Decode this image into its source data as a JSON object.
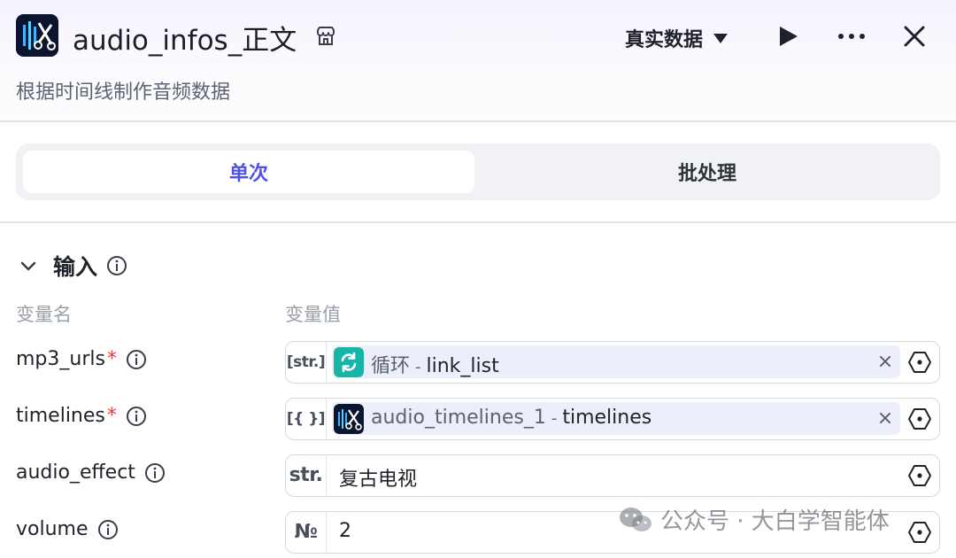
{
  "header": {
    "title": "audio_infos_正文",
    "subtitle": "根据时间线制作音频数据",
    "mode_label": "真实数据",
    "app_icon": "audio-scissors-icon",
    "title_icon": "store-icon"
  },
  "tabs": [
    {
      "label": "单次",
      "active": true
    },
    {
      "label": "批处理",
      "active": false
    }
  ],
  "input_section": {
    "title": "输入",
    "col_name": "变量名",
    "col_value": "变量值",
    "rows": [
      {
        "name": "mp3_urls",
        "required": "*",
        "type": "[str.]",
        "kind": "ref",
        "source": "循环",
        "sep": "-",
        "variable": "link_list"
      },
      {
        "name": "timelines",
        "required": "*",
        "type": "[{ }]",
        "kind": "ref",
        "source": "audio_timelines_1",
        "sep": "-",
        "variable": "timelines"
      },
      {
        "name": "audio_effect",
        "required": "",
        "type": "str.",
        "kind": "text",
        "value": "复古电视"
      },
      {
        "name": "volume",
        "required": "",
        "type": "№",
        "kind": "text",
        "value": "2"
      }
    ]
  },
  "watermark": {
    "text": "公众号 · 大白学智能体"
  },
  "colors": {
    "accent": "#4d53e8",
    "required": "#e53e3e",
    "loop_icon": "#17b5a6"
  }
}
